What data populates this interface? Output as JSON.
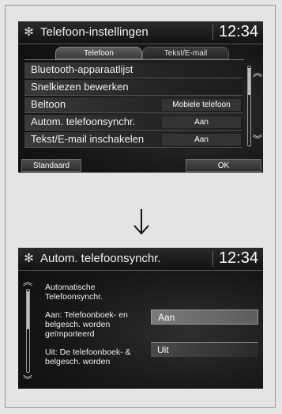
{
  "screen1": {
    "title": "Telefoon-instellingen",
    "clock": "12:34",
    "tabs": [
      "Telefoon",
      "Tekst/E-mail"
    ],
    "menu": [
      {
        "label": "Bluetooth-apparaatlijst",
        "value": ""
      },
      {
        "label": "Snelkiezen bewerken",
        "value": ""
      },
      {
        "label": "Beltoon",
        "value": "Mobiele telefoon"
      },
      {
        "label": "Autom. telefoonsynchr.",
        "value": "Aan"
      },
      {
        "label": "Tekst/E-mail inschakelen",
        "value": "Aan"
      }
    ],
    "buttons": {
      "left": "Standaard",
      "right": "OK"
    }
  },
  "screen2": {
    "title": "Autom. telefoonsynchr.",
    "clock": "12:34",
    "description": [
      "Automatische Telefoonsynchr.",
      "Aan: Telefoonboek- en belgesch. worden geïmporteerd",
      "Uit: De telefoonboek- & belgesch. worden"
    ],
    "options": [
      "Aan",
      "Uit"
    ]
  },
  "icons": {
    "settings": "gear-icon",
    "scroll_up": "double-chevron-up-icon",
    "scroll_down": "double-chevron-down-icon",
    "transition": "down-arrow-icon"
  }
}
